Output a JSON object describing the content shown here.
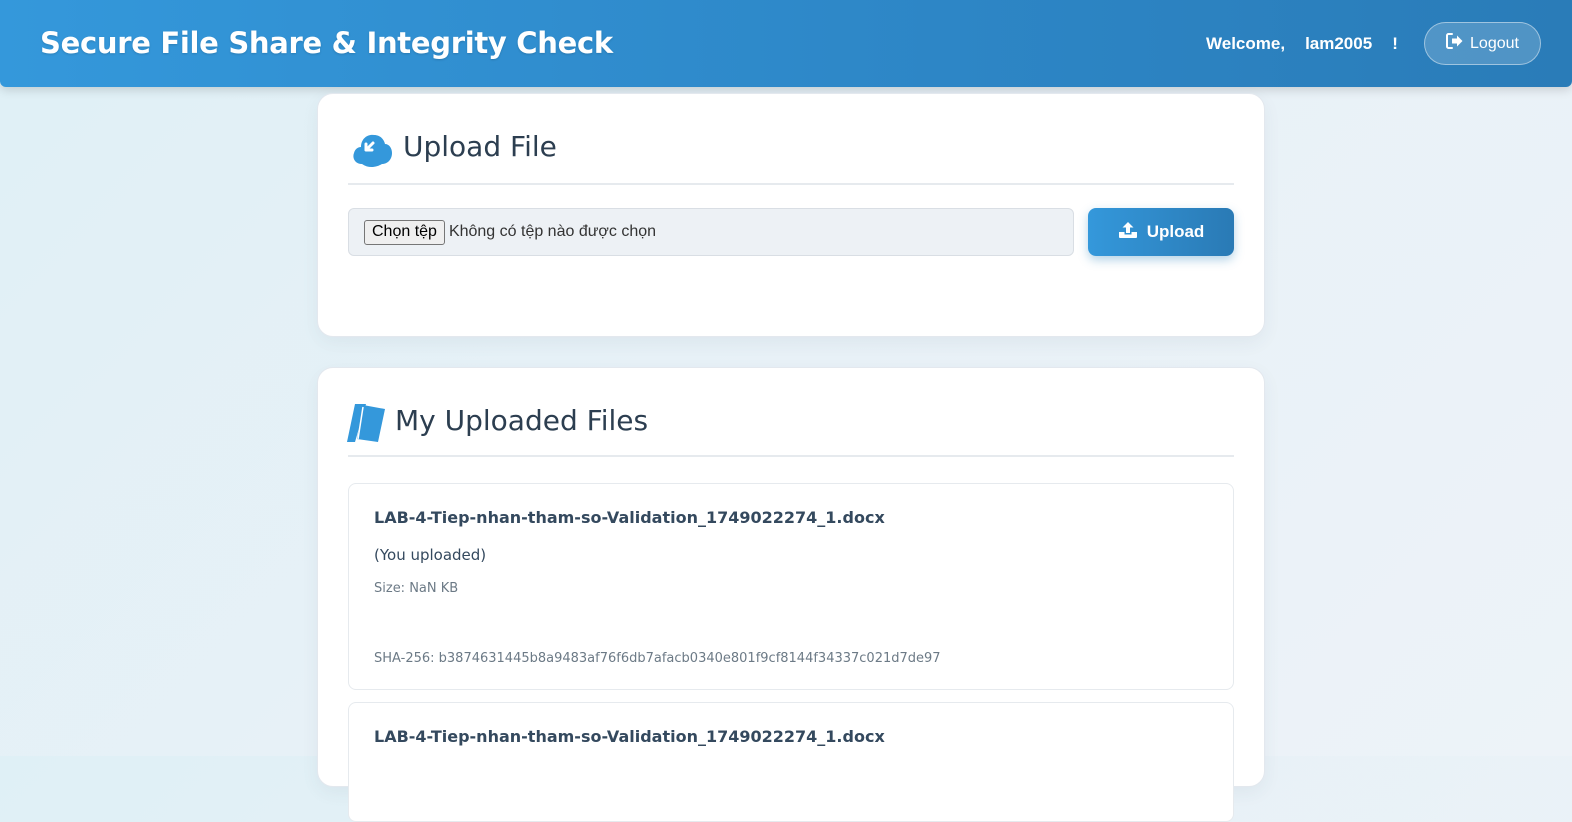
{
  "header": {
    "title": "Secure File Share & Integrity Check",
    "welcome_label": "Welcome,",
    "username": "lam2005",
    "welcome_suffix": "!",
    "logout_label": "Logout"
  },
  "upload_card": {
    "title": "Upload File",
    "choose_button_label": "Chọn tệp",
    "no_file_text": "Không có tệp nào được chọn",
    "upload_button_label": "Upload"
  },
  "files_card": {
    "title": "My Uploaded Files",
    "files": [
      {
        "name": "LAB-4-Tiep-nhan-tham-so-Validation_1749022274_1.docx",
        "owner": "(You uploaded)",
        "size": "Size: NaN KB",
        "hash": "SHA-256: b3874631445b8a9483af76f6db7afacb0340e801f9cf8144f34337c021d7de97"
      },
      {
        "name": "LAB-4-Tiep-nhan-tham-so-Validation_1749022274_1.docx"
      }
    ]
  },
  "colors": {
    "accent": "#3498db",
    "accent_dark": "#2a7ab5",
    "text_dark": "#2c3e50"
  },
  "icons": {
    "logout": "sign-out-icon",
    "upload_card": "cloud-upload-icon",
    "files_card": "files-icon",
    "upload_button": "upload-icon"
  }
}
